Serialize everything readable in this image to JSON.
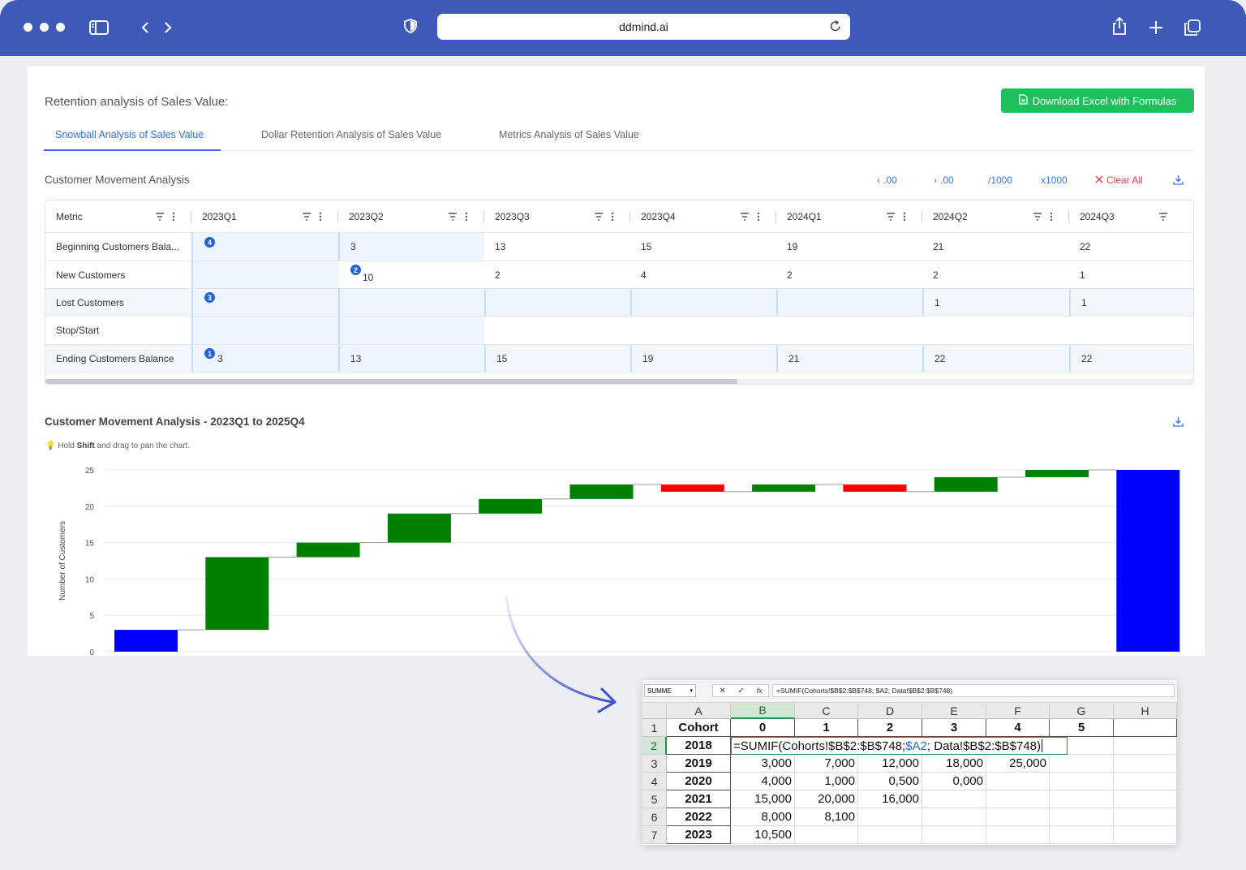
{
  "browser": {
    "url": "ddmind.ai"
  },
  "page": {
    "title": "Retention analysis of Sales Value:",
    "download_button": "Download Excel with Formulas",
    "tabs": [
      {
        "label": "Snowball Analysis of Sales Value",
        "active": true
      },
      {
        "label": "Dollar Retention Analysis of Sales Value",
        "active": false
      },
      {
        "label": "Metrics Analysis of Sales Value",
        "active": false
      }
    ]
  },
  "movement": {
    "title": "Customer Movement Analysis",
    "tools": {
      "decrease_decimals": ".00",
      "increase_decimals": ".00",
      "divide_1000": "/1000",
      "multiply_1000": "x1000",
      "clear_all": "Clear All"
    },
    "columns": [
      "Metric",
      "2023Q1",
      "2023Q2",
      "2023Q3",
      "2023Q4",
      "2024Q1",
      "2024Q2",
      "2024Q3"
    ],
    "rows": [
      {
        "metric": "Beginning Customers Bala...",
        "values": [
          "",
          "3",
          "13",
          "15",
          "19",
          "21",
          "22"
        ],
        "badge": "4"
      },
      {
        "metric": "New Customers",
        "values": [
          "",
          "10",
          "2",
          "4",
          "2",
          "2",
          "1"
        ],
        "badge": "2"
      },
      {
        "metric": "Lost Customers",
        "values": [
          "",
          "",
          "",
          "",
          "",
          "1",
          "1"
        ],
        "badge": "3"
      },
      {
        "metric": "Stop/Start",
        "values": [
          "",
          "",
          "",
          "",
          "",
          "",
          ""
        ]
      },
      {
        "metric": "Ending Customers Balance",
        "values": [
          "3",
          "13",
          "15",
          "19",
          "21",
          "22",
          "22"
        ],
        "badge": "1"
      }
    ]
  },
  "chart_section": {
    "title": "Customer Movement Analysis - 2023Q1 to 2025Q4",
    "hint_prefix": "Hold ",
    "hint_bold": "Shift",
    "hint_suffix": " and drag to pan the chart."
  },
  "chart_data": {
    "type": "bar",
    "subtype": "waterfall",
    "ylabel": "Number of Customers",
    "ylim": [
      0,
      25
    ],
    "yticks": [
      0,
      5,
      10,
      15,
      20,
      25
    ],
    "bars": [
      {
        "start": 0,
        "end": 3,
        "kind": "total"
      },
      {
        "start": 3,
        "end": 13,
        "kind": "increase"
      },
      {
        "start": 13,
        "end": 15,
        "kind": "increase"
      },
      {
        "start": 15,
        "end": 19,
        "kind": "increase"
      },
      {
        "start": 19,
        "end": 21,
        "kind": "increase"
      },
      {
        "start": 21,
        "end": 23,
        "kind": "increase"
      },
      {
        "start": 23,
        "end": 22,
        "kind": "decrease"
      },
      {
        "start": 22,
        "end": 23,
        "kind": "increase"
      },
      {
        "start": 23,
        "end": 22,
        "kind": "decrease"
      },
      {
        "start": 22,
        "end": 24,
        "kind": "increase"
      },
      {
        "start": 24,
        "end": 25,
        "kind": "increase"
      },
      {
        "start": 0,
        "end": 25,
        "kind": "total"
      }
    ],
    "colors": {
      "total": "#0000ff",
      "increase": "#008000",
      "decrease": "#ff0000",
      "connector": "#999999"
    }
  },
  "excel": {
    "name_box": "SUMME",
    "formula_bar": "=SUMIF(Cohorts!$B$2:$B$748; $A2; Data!$B$2:$B$748)",
    "columns": [
      "A",
      "B",
      "C",
      "D",
      "E",
      "F",
      "G",
      "H"
    ],
    "row_numbers": [
      "1",
      "2",
      "3",
      "4",
      "5",
      "6",
      "7"
    ],
    "header_row": [
      "Cohort",
      "0",
      "1",
      "2",
      "3",
      "4",
      "5",
      ""
    ],
    "formula_parts": {
      "pre": "=SUMIF(Cohorts!$B$2:$B$748; ",
      "ref": "$A2",
      "post": "; Data!$B$2:$B$748)"
    },
    "rows": [
      {
        "cohort": "2018",
        "values": []
      },
      {
        "cohort": "2019",
        "values": [
          "3,000",
          "7,000",
          "12,000",
          "18,000",
          "25,000"
        ]
      },
      {
        "cohort": "2020",
        "values": [
          "4,000",
          "1,000",
          "0,500",
          "0,000"
        ]
      },
      {
        "cohort": "2021",
        "values": [
          "15,000",
          "20,000",
          "16,000"
        ]
      },
      {
        "cohort": "2022",
        "values": [
          "8,000",
          "8,100"
        ]
      },
      {
        "cohort": "2023",
        "values": [
          "10,500"
        ]
      }
    ]
  }
}
